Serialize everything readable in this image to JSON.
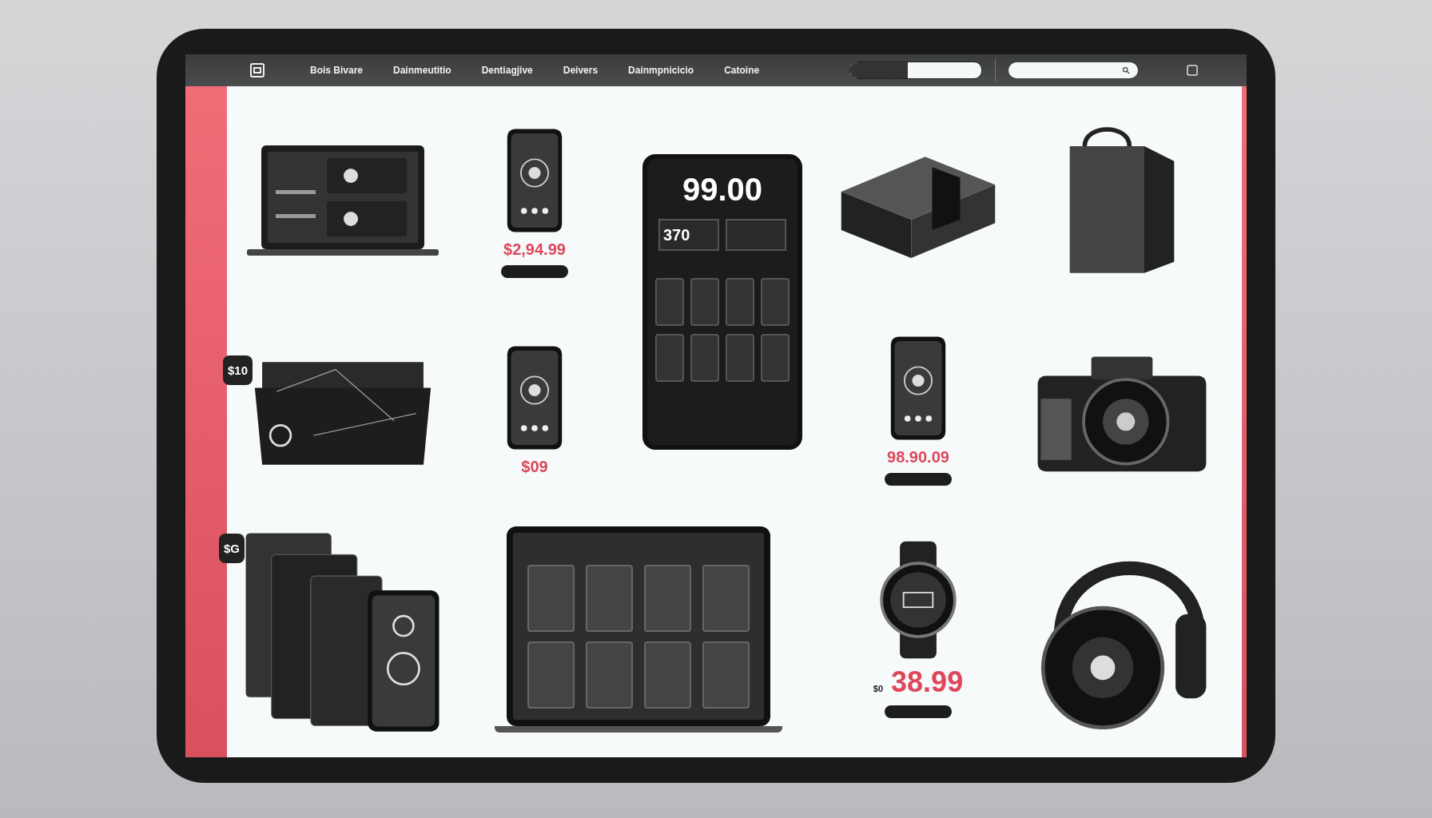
{
  "nav": {
    "items": [
      "Bois Bivare",
      "Dainmeutitio",
      "Dentiagjive",
      "Deivers",
      "Dainmpnicicio",
      "Catoine"
    ]
  },
  "products": [
    {
      "kind": "laptop"
    },
    {
      "kind": "phone",
      "price": "$2,94.99",
      "button": true
    },
    {
      "kind": "bigphone",
      "headline": "99.00",
      "tile_text": "370"
    },
    {
      "kind": "box"
    },
    {
      "kind": "bag"
    },
    {
      "kind": "openbox",
      "badge": "$10"
    },
    {
      "kind": "phone",
      "price": "$09",
      "button": false
    },
    {
      "kind": "phone",
      "price": "98.90.09",
      "button": true
    },
    {
      "kind": "camera"
    },
    {
      "kind": "folio",
      "badge": "$G"
    },
    {
      "kind": "tablet"
    },
    {
      "kind": "watch",
      "price": "38.99",
      "price_prefix": "$0",
      "button": true
    },
    {
      "kind": "headphones"
    }
  ]
}
